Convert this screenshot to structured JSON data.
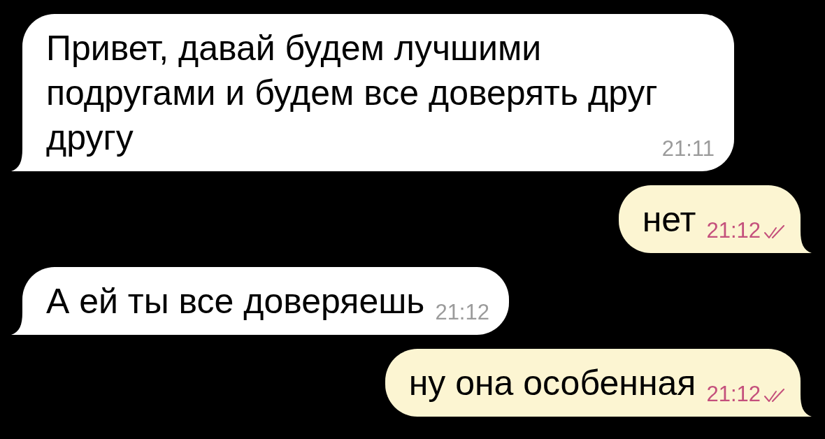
{
  "messages": [
    {
      "kind": "incoming",
      "text": "Привет, давай будем лучшими подругами и будем все доверять друг другу",
      "time": "21:11"
    },
    {
      "kind": "outgoing",
      "text": "нет",
      "time": "21:12",
      "read": true
    },
    {
      "kind": "incoming",
      "text": "А ей ты все доверяешь",
      "time": "21:12"
    },
    {
      "kind": "outgoing",
      "text": "ну она особенная",
      "time": "21:12",
      "read": true
    }
  ]
}
